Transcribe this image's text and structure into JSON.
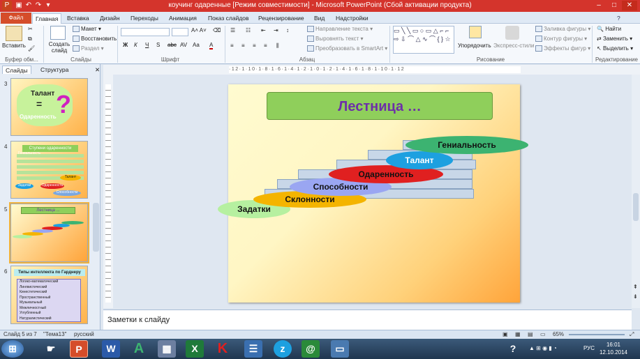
{
  "window": {
    "title": "коучинг одаренные [Режим совместимости] - Microsoft PowerPoint (Сбой активации продукта)",
    "qat_app": "P"
  },
  "tabs": [
    "Файл",
    "Главная",
    "Вставка",
    "Дизайн",
    "Переходы",
    "Анимация",
    "Показ слайдов",
    "Рецензирование",
    "Вид",
    "Надстройки"
  ],
  "ribbon": {
    "paste": "Вставить",
    "clipboard_group": "Буфер обм...",
    "new_slide": "Создать слайд",
    "layout": "Макет",
    "reset": "Восстановить",
    "section": "Раздел",
    "slides_group": "Слайды",
    "font_group": "Шрифт",
    "text_direction": "Направление текста",
    "align_text": "Выровнять текст",
    "smartart": "Преобразовать в SmartArt",
    "paragraph_group": "Абзац",
    "arrange": "Упорядочить",
    "quick_styles": "Экспресс-стили",
    "shape_fill": "Заливка фигуры",
    "shape_outline": "Контур фигуры",
    "shape_effects": "Эффекты фигур",
    "drawing_group": "Рисование",
    "find": "Найти",
    "replace": "Заменить",
    "select": "Выделить",
    "editing_group": "Редактирование"
  },
  "panel": {
    "tab_slides": "Слайды",
    "tab_outline": "Структура",
    "thumbs": [
      {
        "num": "3",
        "title": "Талант",
        "eq": "=",
        "mark": "?",
        "word": "Одаренность"
      },
      {
        "num": "4",
        "title": "Ступени одаренности",
        "items": [
          "Гениальность",
          "Талант",
          "Задатки",
          "Одаренность",
          "Способности"
        ]
      },
      {
        "num": "5",
        "title": "Лестница ..."
      },
      {
        "num": "6",
        "title": "Типы интеллекта по Гарднеру",
        "items": [
          "Логико-математический",
          "Лингвистический",
          "Кинестетический",
          "Пространственный",
          "Музыкальный",
          "Межличностный",
          "Углубленный",
          "Натуралистический"
        ]
      }
    ]
  },
  "ruler": "·12·1·10·1·8·1·6·1·4·1·2·1·0·1·2·1·4·1·6·1·8·1·10·1·12",
  "slide": {
    "title": "Лестница …",
    "steps": [
      "Задатки",
      "Склонности",
      "Способности",
      "Одаренность",
      "Талант",
      "Гениальность"
    ]
  },
  "notes_placeholder": "Заметки к слайду",
  "status": {
    "slide": "Слайд 5 из 7",
    "theme": "\"Тема13\"",
    "lang": "русский",
    "zoom": "65%"
  },
  "clock": {
    "lang": "РУС",
    "time": "16:01",
    "date": "12.10.2014"
  }
}
